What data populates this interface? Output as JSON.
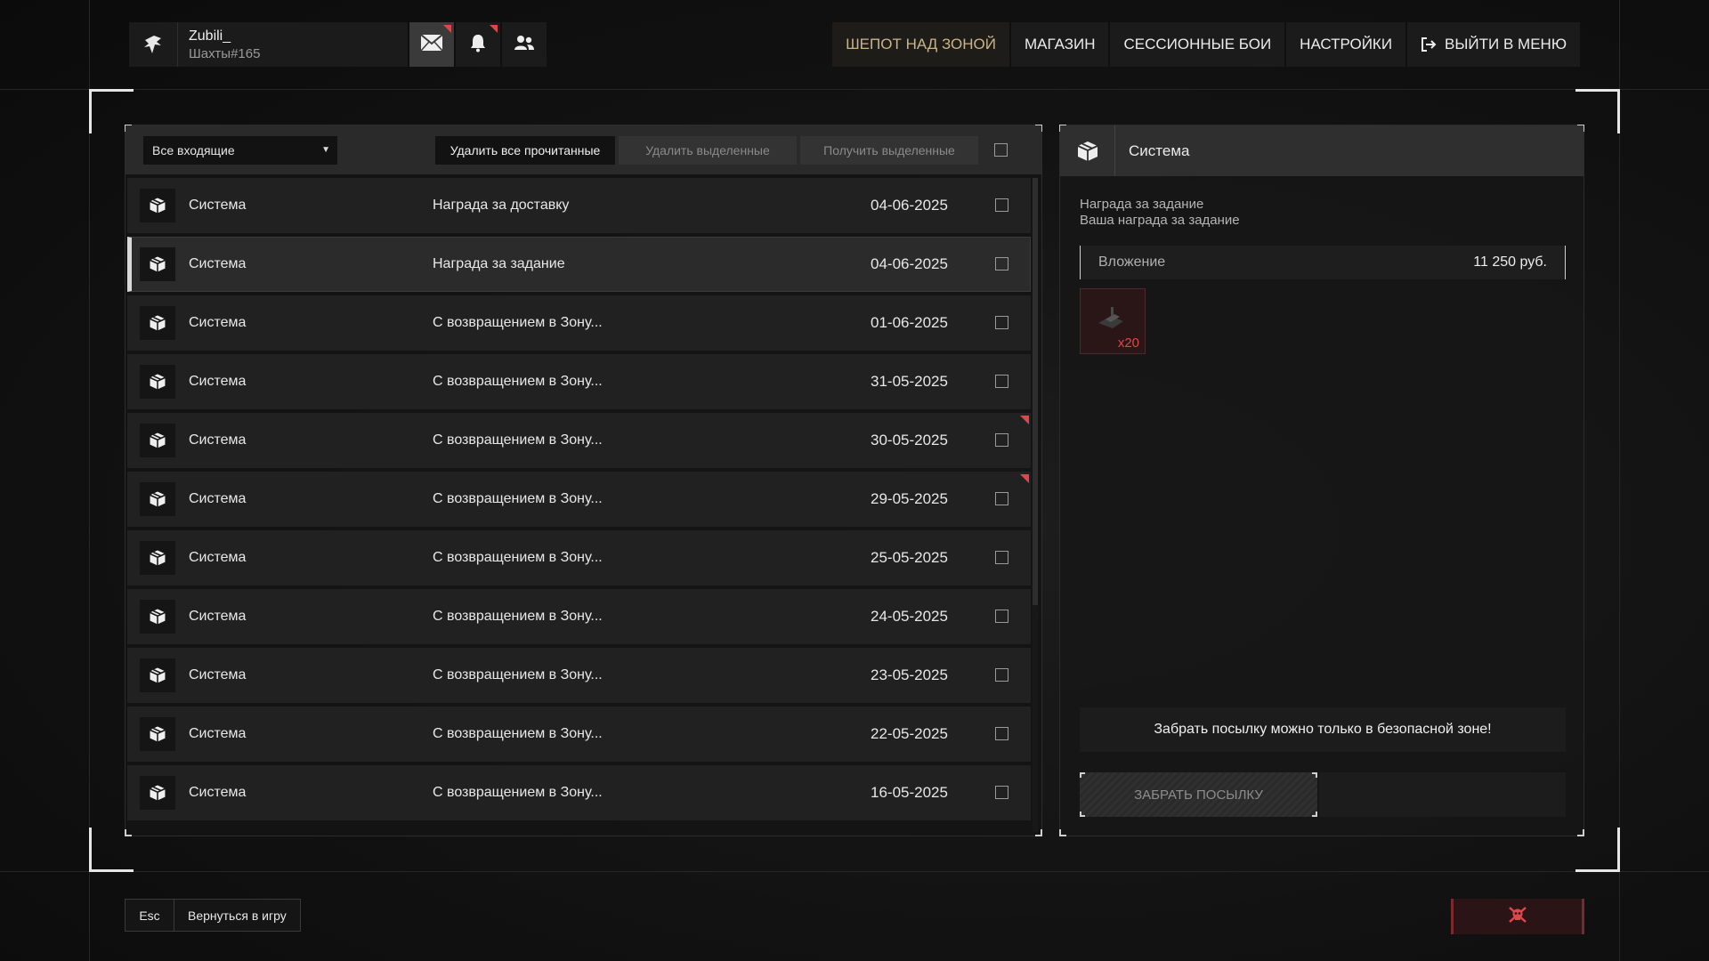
{
  "user": {
    "name": "Zubili_",
    "tag": "Шахты#165"
  },
  "top_icons": [
    {
      "name": "mail-icon",
      "active": true,
      "badge": true
    },
    {
      "name": "bell-icon",
      "active": false,
      "badge": true
    },
    {
      "name": "friends-icon",
      "active": false,
      "badge": false
    }
  ],
  "nav": {
    "items": [
      "ШЕПОТ НАД ЗОНОЙ",
      "МАГАЗИН",
      "СЕССИОННЫЕ БОИ",
      "НАСТРОЙКИ"
    ],
    "exit_label": "ВЫЙТИ В МЕНЮ",
    "active_index": 0,
    "active_color": "#c9b48a"
  },
  "toolbar": {
    "filter": "Все входящие",
    "delete_read": "Удалить все прочитанные",
    "delete_selected": "Удалить выделенные",
    "receive_selected": "Получить выделенные"
  },
  "messages": [
    {
      "sender": "Система",
      "subject": "Награда за доставку",
      "date": "04-06-2025",
      "selected": false,
      "flag": false
    },
    {
      "sender": "Система",
      "subject": "Награда за задание",
      "date": "04-06-2025",
      "selected": true,
      "flag": false
    },
    {
      "sender": "Система",
      "subject": "С возвращением в Зону...",
      "date": "01-06-2025",
      "selected": false,
      "flag": false
    },
    {
      "sender": "Система",
      "subject": "С возвращением в Зону...",
      "date": "31-05-2025",
      "selected": false,
      "flag": false
    },
    {
      "sender": "Система",
      "subject": "С возвращением в Зону...",
      "date": "30-05-2025",
      "selected": false,
      "flag": true
    },
    {
      "sender": "Система",
      "subject": "С возвращением в Зону...",
      "date": "29-05-2025",
      "selected": false,
      "flag": true
    },
    {
      "sender": "Система",
      "subject": "С возвращением в Зону...",
      "date": "25-05-2025",
      "selected": false,
      "flag": false
    },
    {
      "sender": "Система",
      "subject": "С возвращением в Зону...",
      "date": "24-05-2025",
      "selected": false,
      "flag": false
    },
    {
      "sender": "Система",
      "subject": "С возвращением в Зону...",
      "date": "23-05-2025",
      "selected": false,
      "flag": false
    },
    {
      "sender": "Система",
      "subject": "С возвращением в Зону...",
      "date": "22-05-2025",
      "selected": false,
      "flag": false
    },
    {
      "sender": "Система",
      "subject": "С возвращением в Зону...",
      "date": "16-05-2025",
      "selected": false,
      "flag": false
    }
  ],
  "detail": {
    "sender": "Система",
    "title": "Награда за задание",
    "body": "Ваша награда за задание",
    "attachment_label": "Вложение",
    "attachment_value": "11 250 руб.",
    "item_qty": "x20",
    "item_icon": "package-item-icon",
    "warning": "Забрать посылку можно только в безопасной зоне!",
    "take_button": "ЗАБРАТЬ ПОСЫЛКУ"
  },
  "bottom": {
    "key": "Esc",
    "action": "Вернуться в игру",
    "skull_icon": "skull-icon",
    "accent_red": "#d9484a"
  }
}
